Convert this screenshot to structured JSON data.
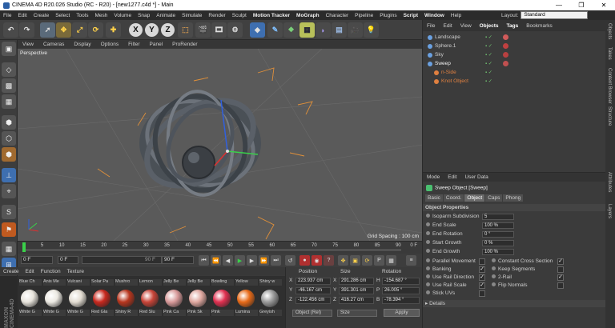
{
  "window": {
    "title": "CINEMA 4D R20.026 Studio (RC - R20) - [new1277.c4d *] - Main",
    "controls": [
      "—",
      "❐",
      "✕"
    ]
  },
  "menubar": {
    "items": [
      "File",
      "Edit",
      "Create",
      "Select",
      "Tools",
      "Mesh",
      "Volume",
      "Snap",
      "Animate",
      "Simulate",
      "Render",
      "Sculpt",
      "Motion Tracker",
      "MoGraph",
      "Character",
      "Pipeline",
      "Plugins",
      "Script",
      "Window",
      "Help"
    ],
    "layout_label": "Layout:",
    "layout_value": "Standard"
  },
  "toolbar": {
    "icons": [
      "undo-icon",
      "redo-icon",
      "select-cursor-icon",
      "move-icon",
      "scale-icon",
      "rotate-icon",
      "add-object-icon",
      "x-axis-icon",
      "y-axis-icon",
      "z-axis-icon",
      "world-coordinate-icon",
      "render-view-icon",
      "render-picture-viewer-icon",
      "render-settings-icon",
      "cube-icon",
      "pen-icon",
      "subdivision-icon",
      "array-icon",
      "deformer-icon",
      "floor-icon",
      "camera-icon",
      "light-icon"
    ],
    "axis_labels": [
      "X",
      "Y",
      "Z"
    ]
  },
  "viewport": {
    "menu": [
      "View",
      "Cameras",
      "Display",
      "Options",
      "Filter",
      "Panel",
      "ProRender"
    ],
    "camera_label": "Perspective",
    "grid_spacing": "Grid Spacing : 100 cm"
  },
  "timeline": {
    "ticks": [
      "0",
      "5",
      "10",
      "15",
      "20",
      "25",
      "30",
      "35",
      "40",
      "45",
      "50",
      "55",
      "60",
      "65",
      "70",
      "75",
      "80",
      "85",
      "90"
    ],
    "end_label": "0 F"
  },
  "transport": {
    "current_frame": "0 F",
    "start_frame": "0 F",
    "end_frame": "90 F",
    "max_frame": "90 F"
  },
  "materials": {
    "menu": [
      "Create",
      "Edit",
      "Function",
      "Texture"
    ],
    "items": [
      {
        "top": "Blue Ch",
        "bottom": "White G",
        "color": "#e8e4dc"
      },
      {
        "top": "Anis Me",
        "bottom": "White G",
        "color": "#ece9e2"
      },
      {
        "top": "Vulcani",
        "bottom": "White G",
        "color": "#e3ddd2"
      },
      {
        "top": "Solar Pa",
        "bottom": "Red Gla",
        "color": "#c8281e"
      },
      {
        "top": "Mushro",
        "bottom": "Shiny R",
        "color": "#b8361e"
      },
      {
        "top": "Lemon",
        "bottom": "Red Slu",
        "color": "#c84438"
      },
      {
        "top": "Jelly Be",
        "bottom": "Pink Ca",
        "color": "#d89a9a"
      },
      {
        "top": "Jelly Be",
        "bottom": "Pink Sk",
        "color": "#e0a8a0"
      },
      {
        "top": "Bowling",
        "bottom": "Pink",
        "color": "#e03050"
      },
      {
        "top": "Yellow",
        "bottom": "Lumina",
        "color": "#e86a18"
      },
      {
        "top": "Shiny w",
        "bottom": "Greyish",
        "color": "#9a9a9a"
      }
    ]
  },
  "coordinates": {
    "headers": [
      "Position",
      "Size",
      "Rotation"
    ],
    "rows": [
      {
        "axis": "X",
        "position": "223.937 cm",
        "size_axis": "X",
        "size": "291.286 cm",
        "rot_axis": "H",
        "rotation": "-154.687 °"
      },
      {
        "axis": "Y",
        "position": "-46.167 cm",
        "size_axis": "Y",
        "size": "391.301 cm",
        "rot_axis": "P",
        "rotation": "26.005 °"
      },
      {
        "axis": "Z",
        "position": "-122.456 cm",
        "size_axis": "Z",
        "size": "416.27 cm",
        "rot_axis": "B",
        "rotation": "-78.394 °"
      }
    ],
    "mode": "Object (Rel)",
    "size_mode": "Size",
    "apply": "Apply"
  },
  "object_manager": {
    "menu": [
      "File",
      "Edit",
      "View",
      "Objects",
      "Tags",
      "Bookmarks"
    ],
    "objects": [
      {
        "name": "Landscape",
        "indent": 0,
        "color": "#cfcfcf",
        "tag": "#d05a5a"
      },
      {
        "name": "Sphere.1",
        "indent": 0,
        "color": "#cfcfcf",
        "tag": "#c04040"
      },
      {
        "name": "Sky",
        "indent": 0,
        "color": "#cfcfcf",
        "tag": "#b84040"
      },
      {
        "name": "Sweep",
        "indent": 0,
        "color": "#f0f0f0",
        "tag": "#c05050"
      },
      {
        "name": "n-Side",
        "indent": 1,
        "color": "#e08040",
        "tag": ""
      },
      {
        "name": "Knot Object",
        "indent": 1,
        "color": "#e08040",
        "tag": ""
      }
    ]
  },
  "attributes": {
    "menu": [
      "Mode",
      "Edit",
      "User Data"
    ],
    "title": "Sweep Object [Sweep]",
    "tabs": [
      "Basic",
      "Coord.",
      "Object",
      "Caps",
      "Phong"
    ],
    "active_tab": "Object",
    "section": "Object Properties",
    "fields": [
      {
        "label": "Isoparm Subdivision",
        "value": "5"
      },
      {
        "label": "End Scale",
        "value": "100 %"
      },
      {
        "label": "End Rotation",
        "value": "0 °"
      },
      {
        "label": "Start Growth",
        "value": "0 %"
      },
      {
        "label": "End Growth",
        "value": "100 %"
      }
    ],
    "checks_left": [
      {
        "label": "Parallel Movement",
        "checked": ""
      },
      {
        "label": "Banking",
        "checked": "✓"
      },
      {
        "label": "Use Rail Direction",
        "checked": "✓"
      },
      {
        "label": "Use Rail Scale",
        "checked": "✓"
      },
      {
        "label": "Stick UVs",
        "checked": ""
      }
    ],
    "checks_right": [
      {
        "label": "Constant Cross Section",
        "checked": "✓"
      },
      {
        "label": "Keep Segments",
        "checked": ""
      },
      {
        "label": "2-Rail",
        "checked": "✓"
      },
      {
        "label": "Flip Normals",
        "checked": ""
      }
    ],
    "details": "Details"
  },
  "side_tabs": [
    "Objects",
    "Takes",
    "Content Browser",
    "Structure",
    "Attributes",
    "Layers"
  ]
}
